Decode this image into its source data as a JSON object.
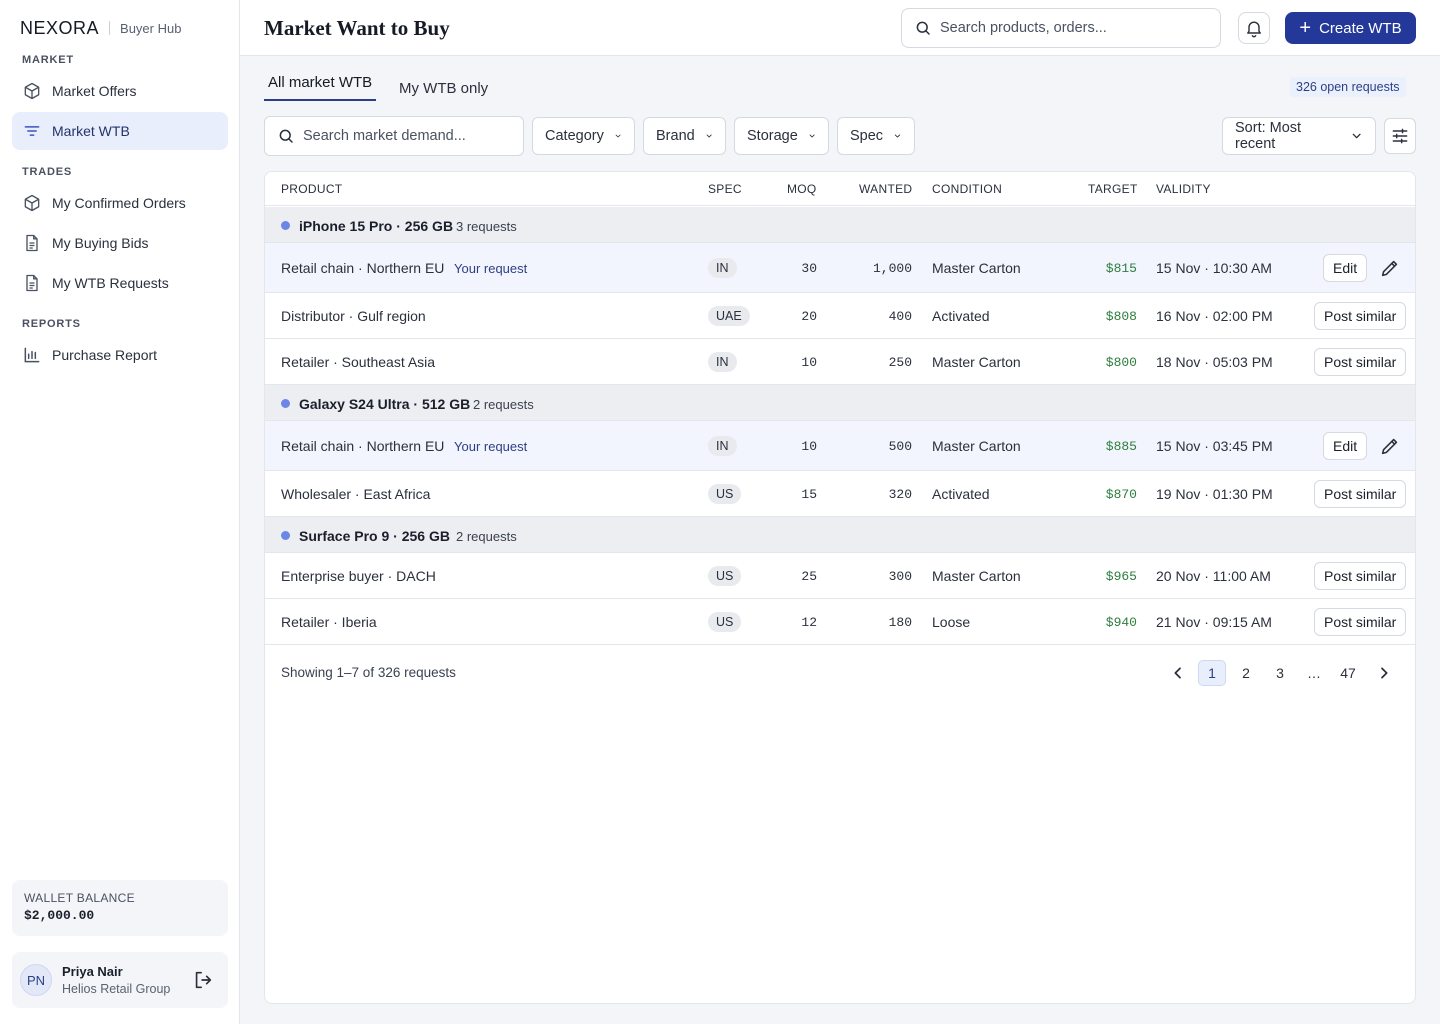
{
  "brand": {
    "logo": "NEXORA",
    "sub": "Buyer Hub"
  },
  "sidebar": {
    "sections": [
      {
        "title": "MARKET",
        "items": [
          {
            "label": "Market Offers",
            "icon": "cube-icon"
          },
          {
            "label": "Market WTB",
            "icon": "filter-icon",
            "active": true
          }
        ]
      },
      {
        "title": "TRADES",
        "items": [
          {
            "label": "My Confirmed Orders",
            "icon": "cube-icon"
          },
          {
            "label": "My Buying Bids",
            "icon": "document-icon"
          },
          {
            "label": "My WTB Requests",
            "icon": "document-icon"
          }
        ]
      },
      {
        "title": "REPORTS",
        "items": [
          {
            "label": "Purchase Report",
            "icon": "bar-chart-icon"
          }
        ]
      }
    ],
    "wallet": {
      "label": "WALLET BALANCE",
      "value": "$2,000.00"
    },
    "user": {
      "initials": "PN",
      "name": "Priya Nair",
      "org": "Helios Retail Group"
    }
  },
  "header": {
    "title": "Market Want to Buy",
    "search_placeholder": "Search products, orders...",
    "create_label": "Create WTB"
  },
  "tabs": [
    {
      "label": "All market WTB",
      "active": true
    },
    {
      "label": "My WTB only",
      "active": false
    }
  ],
  "open_requests": "326 open requests",
  "filters": {
    "search_placeholder": "Search market demand...",
    "dropdowns": [
      "Category",
      "Brand",
      "Storage",
      "Spec"
    ],
    "sort": "Sort: Most recent"
  },
  "table": {
    "columns": [
      "PRODUCT",
      "SPEC",
      "MOQ",
      "WANTED",
      "CONDITION",
      "TARGET",
      "VALIDITY"
    ],
    "your_request_label": "Your request",
    "groups": [
      {
        "product": "iPhone 15 Pro · 256 GB",
        "count": "3 requests",
        "rows": [
          {
            "buyer": "Retail chain · Northern EU",
            "mine": true,
            "spec": "IN",
            "moq": "30",
            "wanted": "1,000",
            "condition": "Master Carton",
            "target": "$815",
            "validity": "15 Nov · 10:30 AM",
            "action": "Edit"
          },
          {
            "buyer": "Distributor · Gulf region",
            "mine": false,
            "spec": "UAE",
            "moq": "20",
            "wanted": "400",
            "condition": "Activated",
            "target": "$808",
            "validity": "16 Nov · 02:00 PM",
            "action": "Post similar"
          },
          {
            "buyer": "Retailer · Southeast Asia",
            "mine": false,
            "spec": "IN",
            "moq": "10",
            "wanted": "250",
            "condition": "Master Carton",
            "target": "$800",
            "validity": "18 Nov · 05:03 PM",
            "action": "Post similar"
          }
        ]
      },
      {
        "product": "Galaxy S24 Ultra · 512 GB",
        "count": "2 requests",
        "rows": [
          {
            "buyer": "Retail chain · Northern EU",
            "mine": true,
            "spec": "IN",
            "moq": "10",
            "wanted": "500",
            "condition": "Master Carton",
            "target": "$885",
            "validity": "15 Nov · 03:45 PM",
            "action": "Edit"
          },
          {
            "buyer": "Wholesaler · East Africa",
            "mine": false,
            "spec": "US",
            "moq": "15",
            "wanted": "320",
            "condition": "Activated",
            "target": "$870",
            "validity": "19 Nov · 01:30 PM",
            "action": "Post similar"
          }
        ]
      },
      {
        "product": "Surface Pro 9 · 256 GB",
        "count": "2 requests",
        "rows": [
          {
            "buyer": "Enterprise buyer · DACH",
            "mine": false,
            "spec": "US",
            "moq": "25",
            "wanted": "300",
            "condition": "Master Carton",
            "target": "$965",
            "validity": "20 Nov · 11:00 AM",
            "action": "Post similar"
          },
          {
            "buyer": "Retailer · Iberia",
            "mine": false,
            "spec": "US",
            "moq": "12",
            "wanted": "180",
            "condition": "Loose",
            "target": "$940",
            "validity": "21 Nov · 09:15 AM",
            "action": "Post similar"
          }
        ]
      }
    ]
  },
  "pagination": {
    "summary": "Showing 1–7 of 326 requests",
    "pages": [
      "1",
      "2",
      "3",
      "…",
      "47"
    ],
    "current": "1"
  }
}
